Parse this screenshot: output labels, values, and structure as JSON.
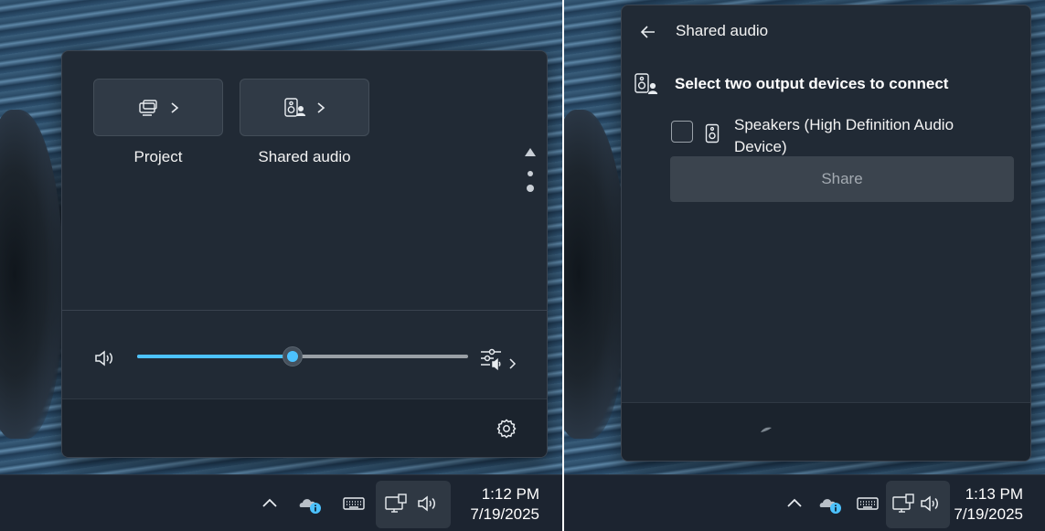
{
  "left": {
    "tiles": [
      {
        "label": "Project",
        "icon": "project-icon"
      },
      {
        "label": "Shared audio",
        "icon": "shared-audio-icon"
      }
    ],
    "volume": {
      "level": 0.47
    },
    "clock": {
      "time": "1:12 PM",
      "date": "7/19/2025"
    }
  },
  "right": {
    "title": "Shared audio",
    "heading": "Select two output devices to connect",
    "devices": [
      {
        "name": "Speakers (High Definition Audio Device)",
        "checked": false
      }
    ],
    "share_label": "Share",
    "clock": {
      "time": "1:13 PM",
      "date": "7/19/2025"
    }
  },
  "colors": {
    "accent": "#4cc2ff",
    "panel": "#212a35",
    "taskbar": "#1c2430"
  },
  "tray_icons": [
    "chevron-up-icon",
    "onedrive-icon",
    "keyboard-icon",
    "network-icon",
    "volume-icon"
  ]
}
